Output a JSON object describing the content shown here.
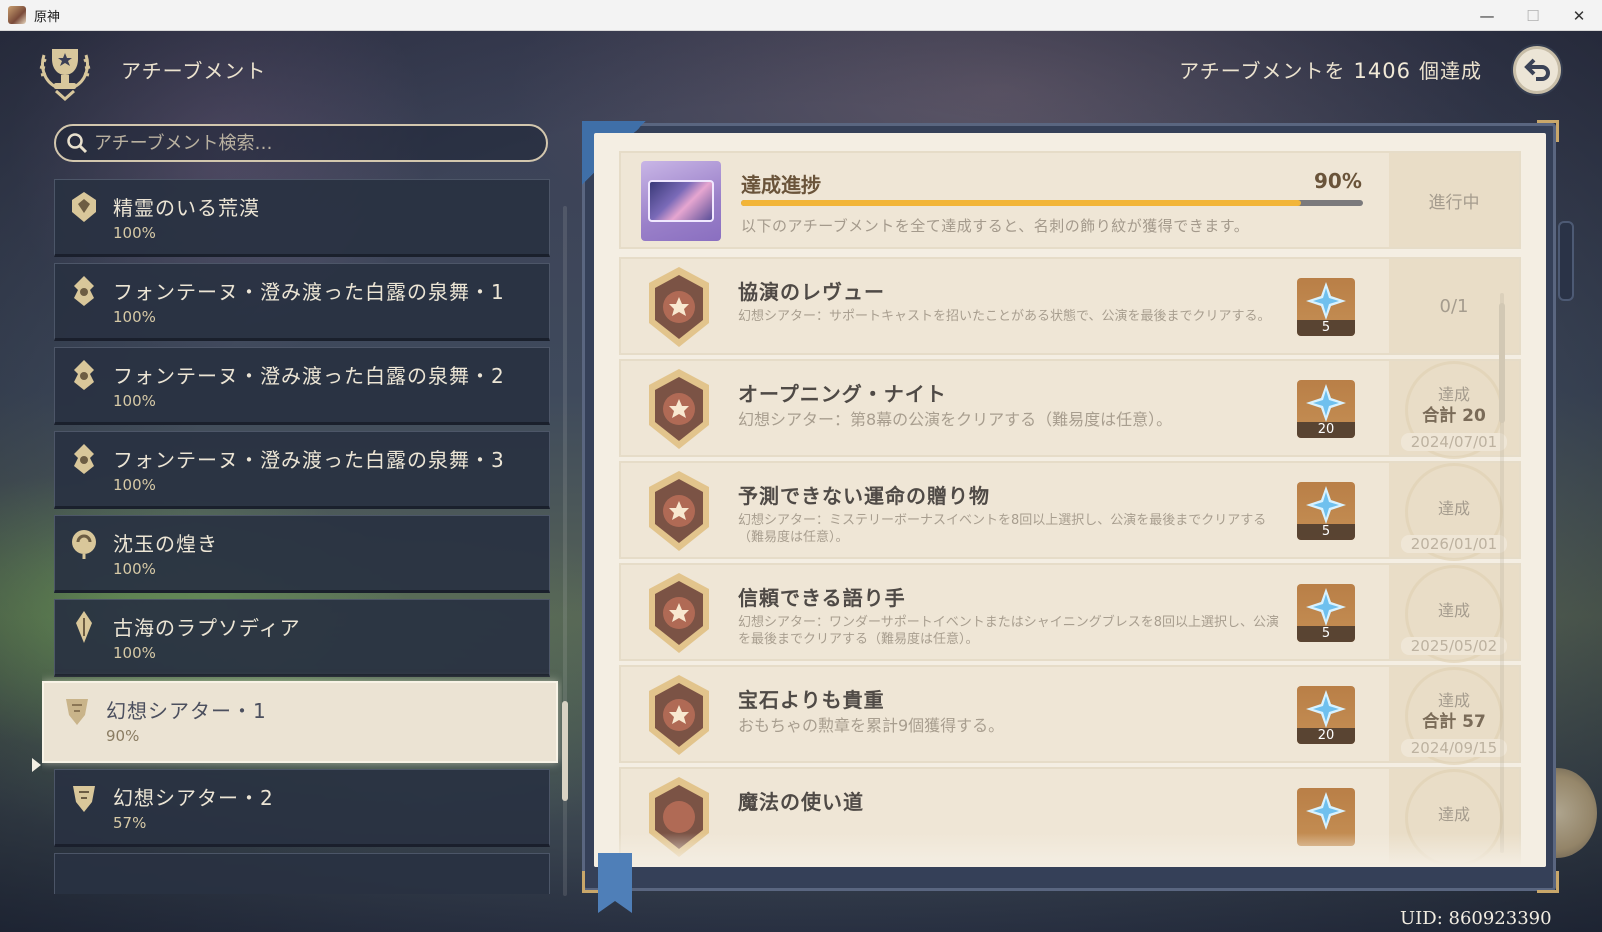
{
  "window": {
    "title": "原神",
    "controls": [
      "—",
      "☐",
      "✕"
    ]
  },
  "header": {
    "title": "アチーブメント",
    "count_prefix": "アチーブメントを",
    "count_value": "1406",
    "count_suffix": "個達成"
  },
  "search": {
    "placeholder": "アチーブメント検索…"
  },
  "categories": [
    {
      "name": "精霊のいる荒漠",
      "percent": "100%"
    },
    {
      "name": "フォンテーヌ・澄み渡った白露の泉舞・1",
      "percent": "100%"
    },
    {
      "name": "フォンテーヌ・澄み渡った白露の泉舞・2",
      "percent": "100%"
    },
    {
      "name": "フォンテーヌ・澄み渡った白露の泉舞・3",
      "percent": "100%"
    },
    {
      "name": "沈玉の煌き",
      "percent": "100%"
    },
    {
      "name": "古海のラプソディア",
      "percent": "100%"
    },
    {
      "name": "幻想シアター・1",
      "percent": "90%",
      "active": true
    },
    {
      "name": "幻想シアター・2",
      "percent": "57%"
    }
  ],
  "progress": {
    "title": "達成進捗",
    "percent": "90%",
    "fraction": 0.9,
    "description": "以下のアチーブメントを全て達成すると、名刺の飾り紋が獲得できます。",
    "status": "進行中"
  },
  "achievements": [
    {
      "title": "協演のレヴュー",
      "description": "幻想シアター：サポートキャストを招いたことがある状態で、公演を最後までクリアする。",
      "reward": "5",
      "progress": "0/1"
    },
    {
      "title": "オープニング・ナイト",
      "description": "幻想シアター：第8幕の公演をクリアする（難易度は任意）。",
      "reward": "20",
      "stamp": "達成",
      "total": "合計 20",
      "date": "2024/07/01"
    },
    {
      "title": "予測できない運命の贈り物",
      "description": "幻想シアター：ミステリーボーナスイベントを8回以上選択し、公演を最後までクリアする（難易度は任意）。",
      "reward": "5",
      "stamp": "達成",
      "date": "2026/01/01"
    },
    {
      "title": "信頼できる語り手",
      "description": "幻想シアター：ワンダーサポートイベントまたはシャイニングブレスを8回以上選択し、公演を最後までクリアする（難易度は任意）。",
      "reward": "5",
      "stamp": "達成",
      "date": "2025/05/02"
    },
    {
      "title": "宝石よりも貴重",
      "description": "おもちゃの勲章を累計9個獲得する。",
      "reward": "20",
      "stamp": "達成",
      "total": "合計 57",
      "date": "2024/09/15"
    },
    {
      "title": "魔法の使い道",
      "reward": "",
      "stamp": "達成"
    }
  ],
  "uid": "UID: 860923390",
  "colors": {
    "accent_gold": "#f2b538",
    "panel_dark": "#293242",
    "page_cream": "#f4eee3",
    "reward_bg": "#c58f54"
  }
}
